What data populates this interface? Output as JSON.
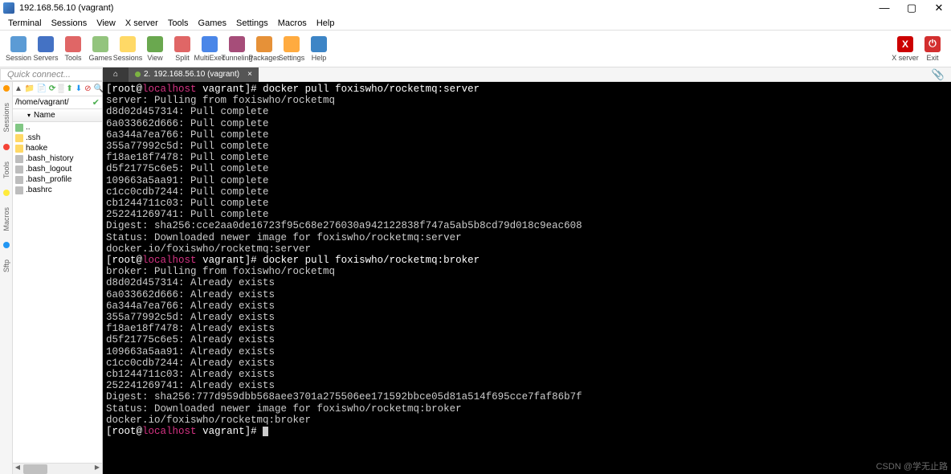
{
  "window": {
    "title": "192.168.56.10 (vagrant)"
  },
  "menu": [
    "Terminal",
    "Sessions",
    "View",
    "X server",
    "Tools",
    "Games",
    "Settings",
    "Macros",
    "Help"
  ],
  "toolbar": {
    "items": [
      {
        "label": "Session",
        "color": "#5b9bd5"
      },
      {
        "label": "Servers",
        "color": "#4472c4"
      },
      {
        "label": "Tools",
        "color": "#e06666"
      },
      {
        "label": "Games",
        "color": "#93c47d"
      },
      {
        "label": "Sessions",
        "color": "#ffd966"
      },
      {
        "label": "View",
        "color": "#6aa84f"
      },
      {
        "label": "Split",
        "color": "#e06666"
      },
      {
        "label": "MultiExec",
        "color": "#4a86e8"
      },
      {
        "label": "Tunneling",
        "color": "#a64d79"
      },
      {
        "label": "Packages",
        "color": "#e69138"
      },
      {
        "label": "Settings",
        "color": "#ffab40"
      },
      {
        "label": "Help",
        "color": "#3d85c6"
      }
    ],
    "right": [
      {
        "label": "X server",
        "color": "#cc0000",
        "text": "X"
      },
      {
        "label": "Exit",
        "color": "#d32f2f",
        "text": "⏻"
      }
    ]
  },
  "quickbar": {
    "placeholder": "Quick connect...",
    "home_icon": "⌂",
    "tab_index": "2.",
    "tab_label": "192.168.56.10 (vagrant)",
    "close": "×",
    "clip": "📎"
  },
  "sidetabs": [
    "Sessions",
    "Tools",
    "Macros",
    "Sftp"
  ],
  "filepanel": {
    "path": "/home/vagrant/",
    "header": "Name",
    "items": [
      {
        "name": "..",
        "type": "folder-alt"
      },
      {
        "name": ".ssh",
        "type": "folder"
      },
      {
        "name": "haoke",
        "type": "folder"
      },
      {
        "name": ".bash_history",
        "type": "file"
      },
      {
        "name": ".bash_logout",
        "type": "file"
      },
      {
        "name": ".bash_profile",
        "type": "file"
      },
      {
        "name": ".bashrc",
        "type": "file"
      }
    ]
  },
  "terminal": {
    "user": "root",
    "at": "@",
    "host": "localhost",
    "cwd": " vagrant",
    "prompt_end": "]# ",
    "cmd1": "docker pull foxiswho/rocketmq:server",
    "cmd2": "docker pull foxiswho/rocketmq:broker",
    "lines1": [
      "server: Pulling from foxiswho/rocketmq",
      "d8d02d457314: Pull complete",
      "6a033662d666: Pull complete",
      "6a344a7ea766: Pull complete",
      "355a77992c5d: Pull complete",
      "f18ae18f7478: Pull complete",
      "d5f21775c6e5: Pull complete",
      "109663a5aa91: Pull complete",
      "c1cc0cdb7244: Pull complete",
      "cb1244711c03: Pull complete",
      "252241269741: Pull complete",
      "Digest: sha256:cce2aa0de16723f95c68e276030a942122838f747a5ab5b8cd79d018c9eac608",
      "Status: Downloaded newer image for foxiswho/rocketmq:server",
      "docker.io/foxiswho/rocketmq:server"
    ],
    "lines2": [
      "broker: Pulling from foxiswho/rocketmq",
      "d8d02d457314: Already exists",
      "6a033662d666: Already exists",
      "6a344a7ea766: Already exists",
      "355a77992c5d: Already exists",
      "f18ae18f7478: Already exists",
      "d5f21775c6e5: Already exists",
      "109663a5aa91: Already exists",
      "c1cc0cdb7244: Already exists",
      "cb1244711c03: Already exists",
      "252241269741: Already exists",
      "Digest: sha256:777d959dbb568aee3701a275506ee171592bbce05d81a514f695cce7faf86b7f",
      "Status: Downloaded newer image for foxiswho/rocketmq:broker",
      "docker.io/foxiswho/rocketmq:broker"
    ]
  },
  "watermark": "CSDN @学无止路"
}
